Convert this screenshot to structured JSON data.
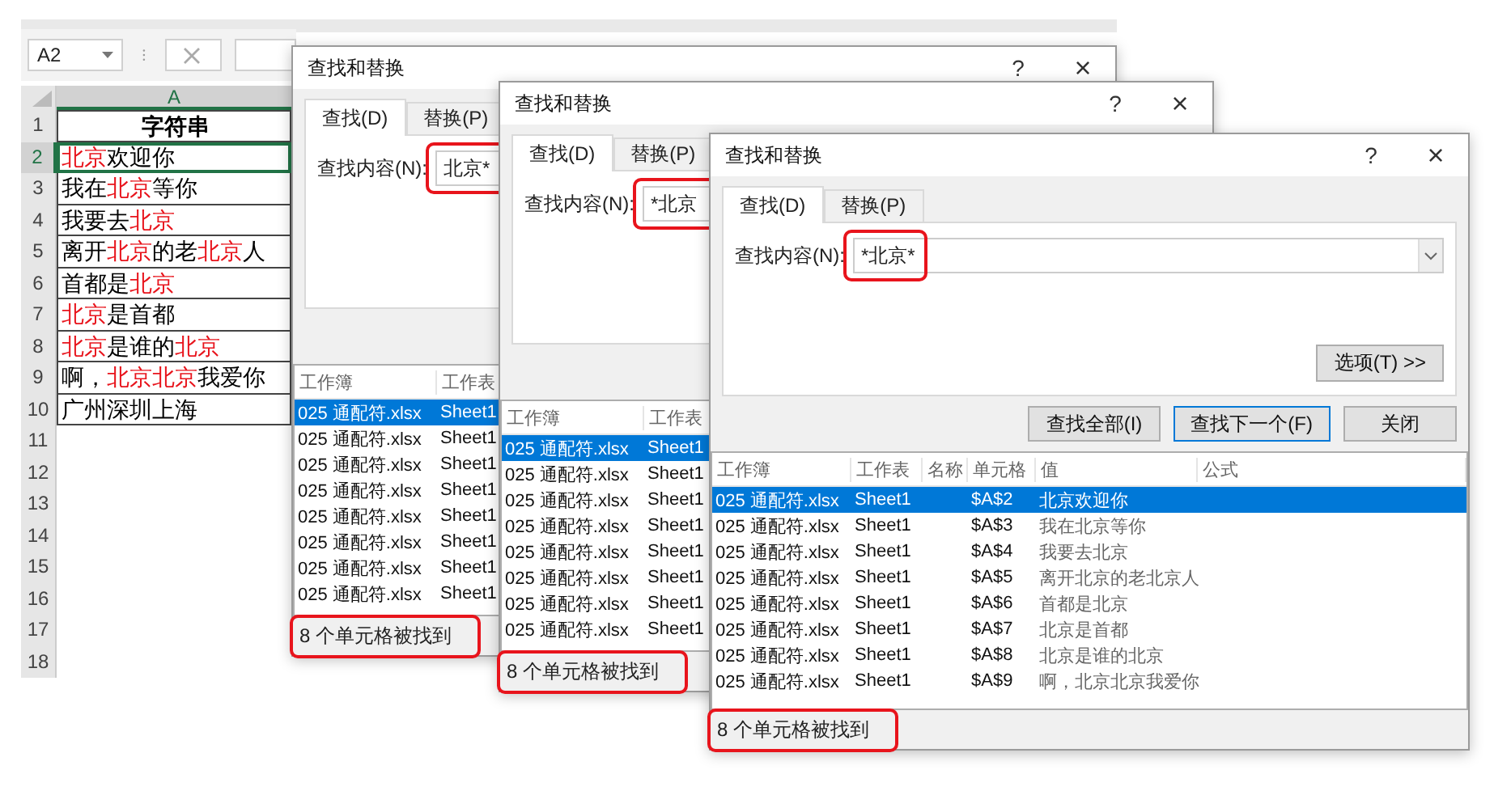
{
  "spreadsheet": {
    "name_box": "A2",
    "column_header": {
      "label": "A",
      "selected": true
    },
    "rows": [
      {
        "number": "1",
        "kind": "header",
        "selected": false,
        "cell": [
          {
            "text": "字符串",
            "highlight": false
          }
        ]
      },
      {
        "number": "2",
        "kind": "text",
        "selected": true,
        "cell": [
          {
            "text": "北京",
            "highlight": true
          },
          {
            "text": "欢迎你",
            "highlight": false
          }
        ]
      },
      {
        "number": "3",
        "kind": "text",
        "selected": false,
        "cell": [
          {
            "text": "我在",
            "highlight": false
          },
          {
            "text": "北京",
            "highlight": true
          },
          {
            "text": "等你",
            "highlight": false
          }
        ]
      },
      {
        "number": "4",
        "kind": "text",
        "selected": false,
        "cell": [
          {
            "text": "我要去",
            "highlight": false
          },
          {
            "text": "北京",
            "highlight": true
          }
        ]
      },
      {
        "number": "5",
        "kind": "text",
        "selected": false,
        "cell": [
          {
            "text": "离开",
            "highlight": false
          },
          {
            "text": "北京",
            "highlight": true
          },
          {
            "text": "的老",
            "highlight": false
          },
          {
            "text": "北京",
            "highlight": true
          },
          {
            "text": "人",
            "highlight": false
          }
        ]
      },
      {
        "number": "6",
        "kind": "text",
        "selected": false,
        "cell": [
          {
            "text": "首都是",
            "highlight": false
          },
          {
            "text": "北京",
            "highlight": true
          }
        ]
      },
      {
        "number": "7",
        "kind": "text",
        "selected": false,
        "cell": [
          {
            "text": "北京",
            "highlight": true
          },
          {
            "text": "是首都",
            "highlight": false
          }
        ]
      },
      {
        "number": "8",
        "kind": "text",
        "selected": false,
        "cell": [
          {
            "text": "北京",
            "highlight": true
          },
          {
            "text": "是谁的",
            "highlight": false
          },
          {
            "text": "北京",
            "highlight": true
          }
        ]
      },
      {
        "number": "9",
        "kind": "text",
        "selected": false,
        "cell": [
          {
            "text": "啊，",
            "highlight": false
          },
          {
            "text": "北京北京",
            "highlight": true
          },
          {
            "text": "我爱你",
            "highlight": false
          }
        ]
      },
      {
        "number": "10",
        "kind": "text",
        "selected": false,
        "cell": [
          {
            "text": "广州深圳上海",
            "highlight": false
          }
        ]
      },
      {
        "number": "11",
        "kind": "blank",
        "selected": false
      },
      {
        "number": "12",
        "kind": "blank",
        "selected": false
      },
      {
        "number": "13",
        "kind": "blank",
        "selected": false
      },
      {
        "number": "14",
        "kind": "blank",
        "selected": false
      },
      {
        "number": "15",
        "kind": "blank",
        "selected": false
      },
      {
        "number": "16",
        "kind": "blank",
        "selected": false
      },
      {
        "number": "17",
        "kind": "blank",
        "selected": false
      },
      {
        "number": "18",
        "kind": "blank",
        "selected": false
      }
    ]
  },
  "dialogs": [
    {
      "title": "查找和替换",
      "help": "?",
      "close": "×",
      "tabs": [
        {
          "label": "查找(D)",
          "selected": true
        },
        {
          "label": "替换(P)",
          "selected": false
        }
      ],
      "find": {
        "label": "查找内容(N):",
        "value": "北京*",
        "highlighted": true
      },
      "columns": [
        "工作簿",
        "工作表"
      ],
      "rows": [
        {
          "workbook": "025 通配符.xlsx",
          "sheet": "Sheet1",
          "selected": true
        },
        {
          "workbook": "025 通配符.xlsx",
          "sheet": "Sheet1",
          "selected": false
        },
        {
          "workbook": "025 通配符.xlsx",
          "sheet": "Sheet1",
          "selected": false
        },
        {
          "workbook": "025 通配符.xlsx",
          "sheet": "Sheet1",
          "selected": false
        },
        {
          "workbook": "025 通配符.xlsx",
          "sheet": "Sheet1",
          "selected": false
        },
        {
          "workbook": "025 通配符.xlsx",
          "sheet": "Sheet1",
          "selected": false
        },
        {
          "workbook": "025 通配符.xlsx",
          "sheet": "Sheet1",
          "selected": false
        },
        {
          "workbook": "025 通配符.xlsx",
          "sheet": "Sheet1",
          "selected": false
        }
      ],
      "status": {
        "text": "8 个单元格被找到",
        "highlighted": true
      }
    },
    {
      "title": "查找和替换",
      "help": "?",
      "close": "×",
      "tabs": [
        {
          "label": "查找(D)",
          "selected": true
        },
        {
          "label": "替换(P)",
          "selected": false
        }
      ],
      "find": {
        "label": "查找内容(N):",
        "value": "*北京",
        "highlighted": true
      },
      "columns": [
        "工作簿",
        "工作表"
      ],
      "rows": [
        {
          "workbook": "025 通配符.xlsx",
          "sheet": "Sheet1",
          "selected": true
        },
        {
          "workbook": "025 通配符.xlsx",
          "sheet": "Sheet1",
          "selected": false
        },
        {
          "workbook": "025 通配符.xlsx",
          "sheet": "Sheet1",
          "selected": false
        },
        {
          "workbook": "025 通配符.xlsx",
          "sheet": "Sheet1",
          "selected": false
        },
        {
          "workbook": "025 通配符.xlsx",
          "sheet": "Sheet1",
          "selected": false
        },
        {
          "workbook": "025 通配符.xlsx",
          "sheet": "Sheet1",
          "selected": false
        },
        {
          "workbook": "025 通配符.xlsx",
          "sheet": "Sheet1",
          "selected": false
        },
        {
          "workbook": "025 通配符.xlsx",
          "sheet": "Sheet1",
          "selected": false
        }
      ],
      "status": {
        "text": "8 个单元格被找到",
        "highlighted": true
      }
    },
    {
      "title": "查找和替换",
      "help": "?",
      "close": "×",
      "tabs": [
        {
          "label": "查找(D)",
          "selected": true
        },
        {
          "label": "替换(P)",
          "selected": false
        }
      ],
      "find": {
        "label": "查找内容(N):",
        "value": "*北京*",
        "highlighted": true,
        "dropdown": true
      },
      "options_button": "选项(T) >>",
      "buttons": [
        {
          "label": "查找全部(I)",
          "default": false
        },
        {
          "label": "查找下一个(F)",
          "default": true
        },
        {
          "label": "关闭",
          "default": false
        }
      ],
      "columns": [
        "工作簿",
        "工作表",
        "名称",
        "单元格",
        "值",
        "公式"
      ],
      "rows": [
        {
          "workbook": "025 通配符.xlsx",
          "sheet": "Sheet1",
          "cell": "$A$2",
          "value": "北京欢迎你",
          "selected": true
        },
        {
          "workbook": "025 通配符.xlsx",
          "sheet": "Sheet1",
          "cell": "$A$3",
          "value": "我在北京等你",
          "selected": false
        },
        {
          "workbook": "025 通配符.xlsx",
          "sheet": "Sheet1",
          "cell": "$A$4",
          "value": "我要去北京",
          "selected": false
        },
        {
          "workbook": "025 通配符.xlsx",
          "sheet": "Sheet1",
          "cell": "$A$5",
          "value": "离开北京的老北京人",
          "selected": false
        },
        {
          "workbook": "025 通配符.xlsx",
          "sheet": "Sheet1",
          "cell": "$A$6",
          "value": "首都是北京",
          "selected": false
        },
        {
          "workbook": "025 通配符.xlsx",
          "sheet": "Sheet1",
          "cell": "$A$7",
          "value": "北京是首都",
          "selected": false
        },
        {
          "workbook": "025 通配符.xlsx",
          "sheet": "Sheet1",
          "cell": "$A$8",
          "value": "北京是谁的北京",
          "selected": false
        },
        {
          "workbook": "025 通配符.xlsx",
          "sheet": "Sheet1",
          "cell": "$A$9",
          "value": "啊，北京北京我爱你",
          "selected": false
        }
      ],
      "status": {
        "text": "8 个单元格被找到",
        "highlighted": true
      }
    }
  ]
}
